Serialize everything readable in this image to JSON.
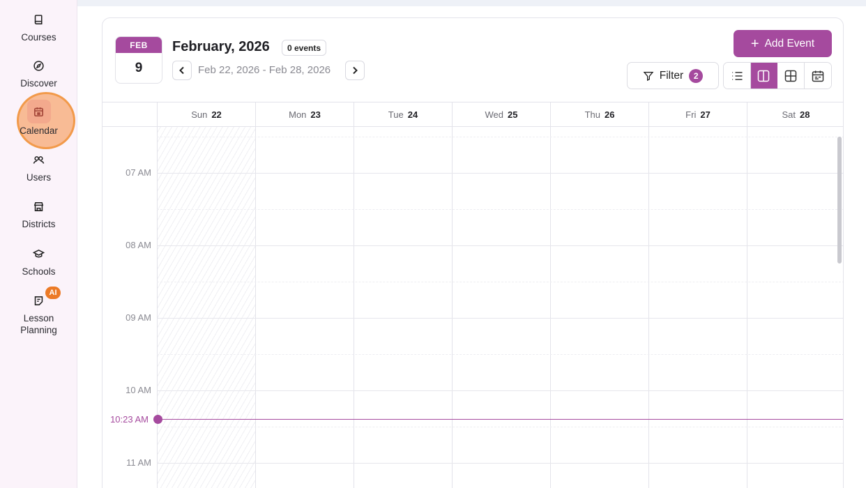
{
  "sidebar": {
    "items": [
      {
        "label": "Courses",
        "icon": "book-icon"
      },
      {
        "label": "Discover",
        "icon": "compass-icon"
      },
      {
        "label": "Calendar",
        "icon": "calendar-icon",
        "active": true
      },
      {
        "label": "Users",
        "icon": "users-icon"
      },
      {
        "label": "Districts",
        "icon": "building-icon"
      },
      {
        "label": "Schools",
        "icon": "graduation-cap-icon"
      },
      {
        "label": "Lesson Planning",
        "icon": "lesson-plan-icon",
        "badge": "AI"
      }
    ]
  },
  "header": {
    "date_tile": {
      "month": "FEB",
      "day": "9"
    },
    "title": "February, 2026",
    "events_count": "0 events",
    "range": "Feb 22, 2026 - Feb 28, 2026",
    "add_event_label": "Add Event",
    "filter_label": "Filter",
    "filter_count": "2",
    "views": [
      "list-view-icon",
      "week-view-icon",
      "month-grid-icon",
      "schedule-view-icon"
    ],
    "active_view": "week-view-icon"
  },
  "calendar": {
    "days": [
      {
        "name": "Sun",
        "date": "22"
      },
      {
        "name": "Mon",
        "date": "23"
      },
      {
        "name": "Tue",
        "date": "24"
      },
      {
        "name": "Wed",
        "date": "25"
      },
      {
        "name": "Thu",
        "date": "26"
      },
      {
        "name": "Fri",
        "date": "27"
      },
      {
        "name": "Sat",
        "date": "28"
      }
    ],
    "hours": [
      "07 AM",
      "08 AM",
      "09 AM",
      "10 AM",
      "11 AM"
    ],
    "current_time": "10:23 AM"
  },
  "colors": {
    "accent": "#a54a9e",
    "highlight": "#f29a4a",
    "badge": "#ec7a26"
  }
}
